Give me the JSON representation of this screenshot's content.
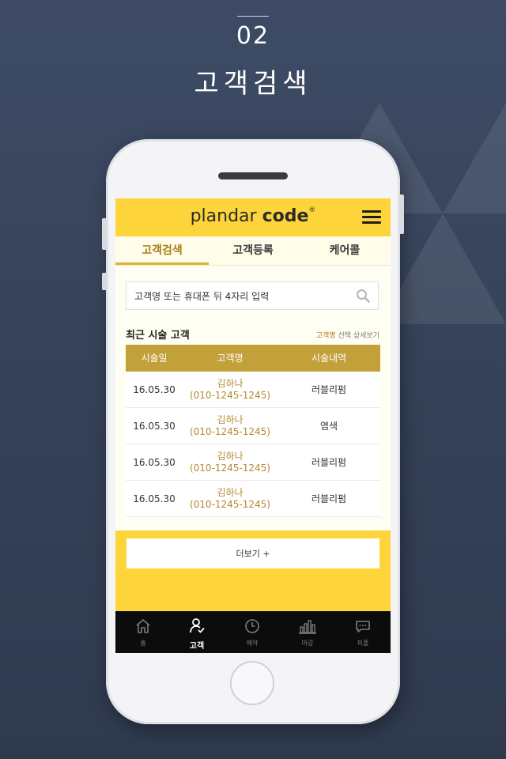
{
  "header": {
    "step": "02",
    "title": "고객검색"
  },
  "app": {
    "logo": {
      "light": "plandar ",
      "bold": "code",
      "mark": "®"
    },
    "tabs": [
      {
        "label": "고객검색",
        "active": true
      },
      {
        "label": "고객등록",
        "active": false
      },
      {
        "label": "케어콜",
        "active": false
      }
    ],
    "search": {
      "placeholder": "고객명 또는 휴대폰 뒤 4자리 입력",
      "value": ""
    },
    "recent": {
      "title": "최근 시술 고객",
      "hint_accent": "고객명",
      "hint_rest": " 선택 상세보기",
      "columns": [
        "시술일",
        "고객명",
        "시술내역"
      ],
      "rows": [
        {
          "date": "16.05.30",
          "name": "김하나",
          "phone": "(010-1245-1245)",
          "service": "러블리펌"
        },
        {
          "date": "16.05.30",
          "name": "김하나",
          "phone": "(010-1245-1245)",
          "service": "염색"
        },
        {
          "date": "16.05.30",
          "name": "김하나",
          "phone": "(010-1245-1245)",
          "service": "러블리펌"
        },
        {
          "date": "16.05.30",
          "name": "김하나",
          "phone": "(010-1245-1245)",
          "service": "러블리펌"
        }
      ]
    },
    "more_label": "더보기 +",
    "bottom_nav": [
      {
        "label": "홈",
        "icon": "home-icon",
        "active": false
      },
      {
        "label": "고객",
        "icon": "customer-icon",
        "active": true
      },
      {
        "label": "예약",
        "icon": "clock-icon",
        "active": false
      },
      {
        "label": "마감",
        "icon": "bar-chart-icon",
        "active": false
      },
      {
        "label": "피플",
        "icon": "chat-icon",
        "active": false
      }
    ],
    "colors": {
      "brand_yellow": "#fdd53b",
      "accent_gold": "#c2a13b",
      "name_text": "#b38a2e"
    }
  }
}
